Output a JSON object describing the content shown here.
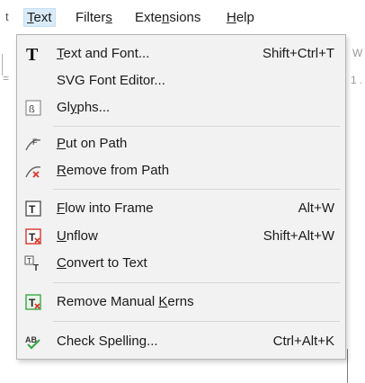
{
  "menubar": {
    "left_fragment": "t",
    "items": [
      {
        "label": "Text",
        "u": "T",
        "rest": "ext"
      },
      {
        "label": "Filters",
        "pre": "Filter",
        "u": "s",
        "rest": ""
      },
      {
        "label": "Extensions",
        "pre": "Exte",
        "u": "n",
        "rest": "sions"
      },
      {
        "label": "Help",
        "u": "H",
        "rest": "elp"
      }
    ]
  },
  "background": {
    "top_right_fragment": "W",
    "left_fragment": "=",
    "right_fragment": "1 ."
  },
  "menu": {
    "items": [
      {
        "icon": "text-font-icon",
        "pre": "",
        "u": "T",
        "rest": "ext and Font...",
        "shortcut": "Shift+Ctrl+T"
      },
      {
        "icon": "",
        "pre": "SVG Font Editor...",
        "u": "",
        "rest": "",
        "shortcut": ""
      },
      {
        "icon": "glyphs-icon",
        "pre": "Gl",
        "u": "y",
        "rest": "phs...",
        "shortcut": ""
      },
      {
        "icon": "put-on-path-icon",
        "pre": "",
        "u": "P",
        "rest": "ut on Path",
        "shortcut": ""
      },
      {
        "icon": "remove-from-path-icon",
        "pre": "",
        "u": "R",
        "rest": "emove from Path",
        "shortcut": ""
      },
      {
        "icon": "flow-into-frame-icon",
        "pre": "",
        "u": "F",
        "rest": "low into Frame",
        "shortcut": "Alt+W"
      },
      {
        "icon": "unflow-icon",
        "pre": "",
        "u": "U",
        "rest": "nflow",
        "shortcut": "Shift+Alt+W"
      },
      {
        "icon": "convert-to-text-icon",
        "pre": "",
        "u": "C",
        "rest": "onvert to Text",
        "shortcut": ""
      },
      {
        "icon": "remove-manual-kerns-icon",
        "pre": "Remove Manual ",
        "u": "K",
        "rest": "erns",
        "shortcut": ""
      },
      {
        "icon": "check-spelling-icon",
        "pre": "Check Spellin",
        "u": "g",
        "rest": "...",
        "shortcut": "Ctrl+Alt+K"
      }
    ]
  },
  "colors": {
    "menu_bg": "#f2f2f2",
    "active_bg": "#d9ebf9",
    "icon_red": "#d9342b",
    "icon_green": "#3aa845"
  }
}
